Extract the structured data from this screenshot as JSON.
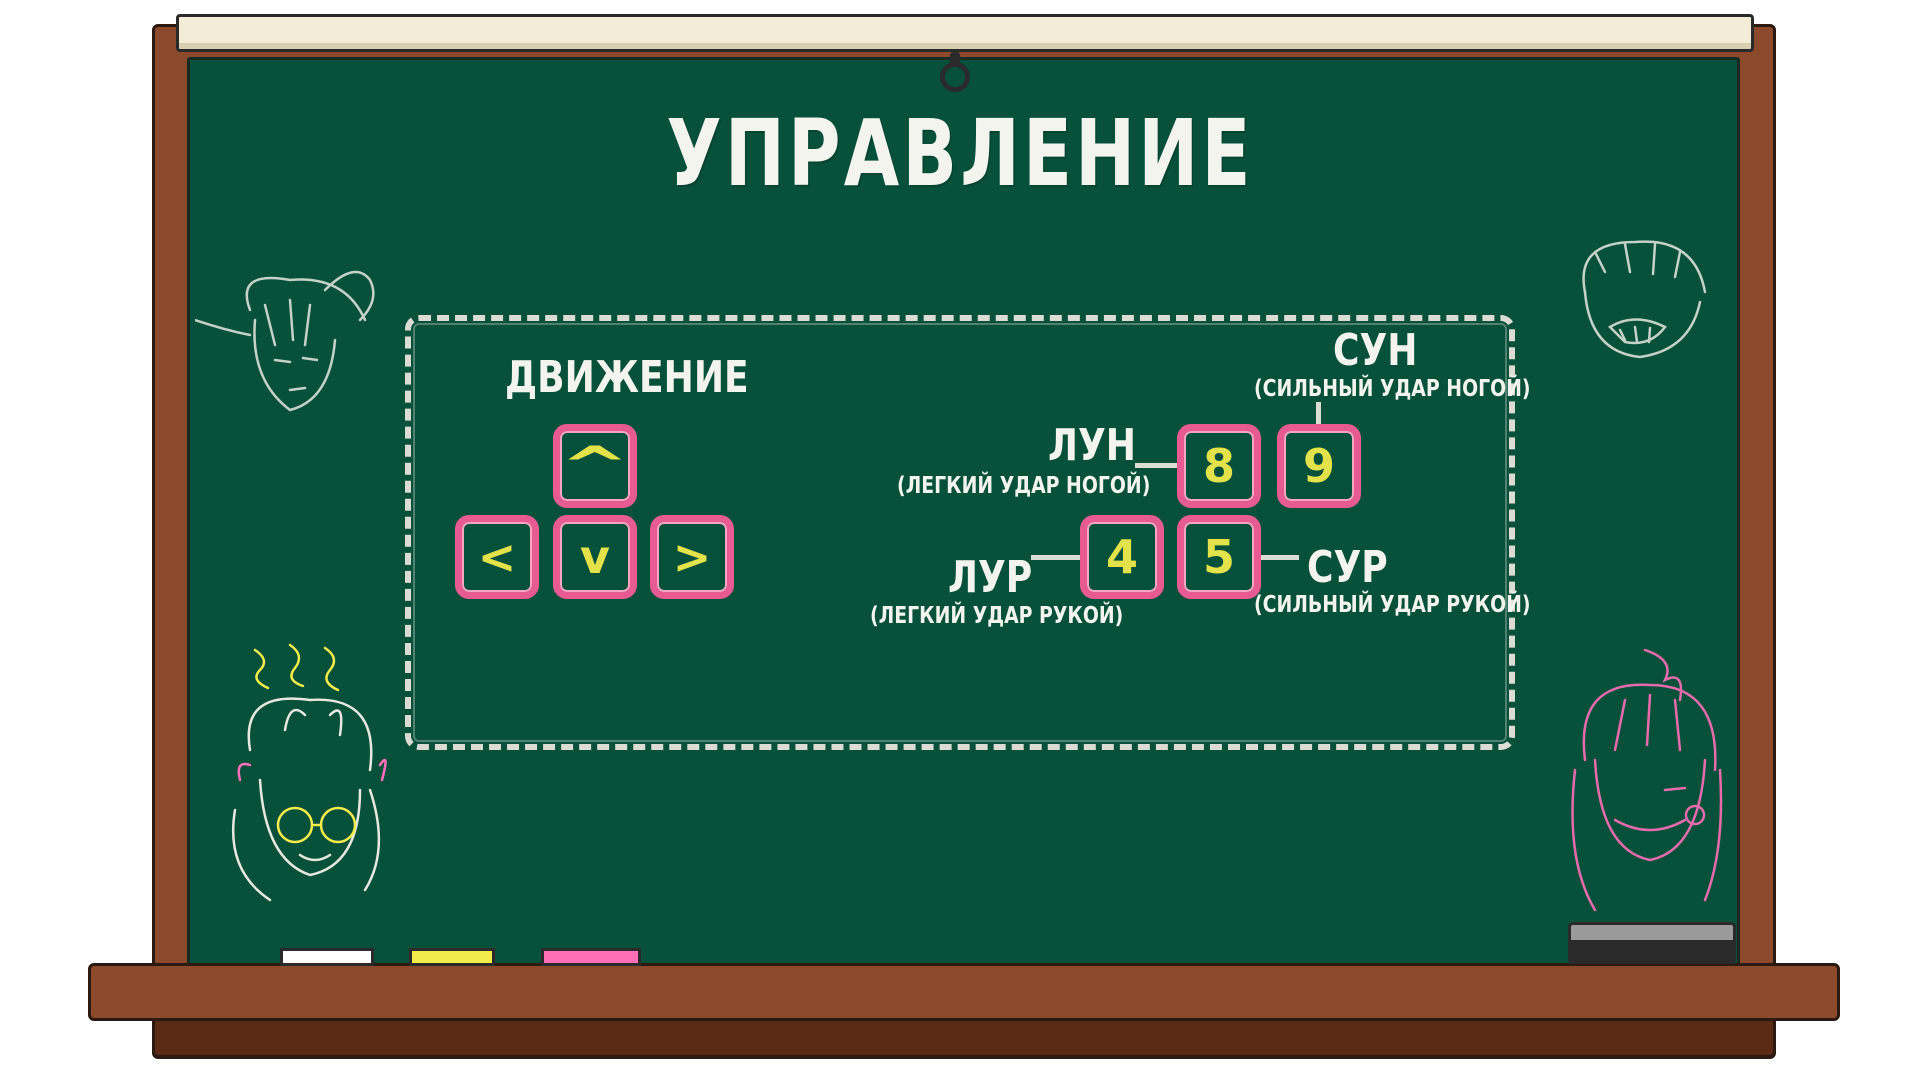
{
  "title": "УПРАВЛЕНИЕ",
  "movement": {
    "label": "ДВИЖЕНИЕ",
    "keys": {
      "up": "^",
      "left": "<",
      "down": "v",
      "right": ">"
    }
  },
  "attacks": {
    "lun": {
      "key": "8",
      "label": "ЛУН",
      "desc": "(ЛЕГКИЙ УДАР НОГОЙ)"
    },
    "sun": {
      "key": "9",
      "label": "СУН",
      "desc": "(СИЛЬНЫЙ УДАР НОГОЙ)"
    },
    "lur": {
      "key": "4",
      "label": "ЛУР",
      "desc": "(ЛЕГКИЙ УДАР РУКОЙ)"
    },
    "sur": {
      "key": "5",
      "label": "СУР",
      "desc": "(СИЛЬНЫЙ УДАР РУКОЙ)"
    }
  },
  "colors": {
    "board": "#07503a",
    "frame": "#8b4a2b",
    "key_border": "#e85b92",
    "key_text": "#e4e24a",
    "chalk_white": "#ffffff",
    "chalk_yellow": "#f4ec4a",
    "chalk_pink": "#ff6fb8"
  },
  "icons": [
    "chalk-face-left-top",
    "chalk-face-right-top",
    "chalk-face-left-bottom",
    "chalk-face-right-bottom"
  ]
}
